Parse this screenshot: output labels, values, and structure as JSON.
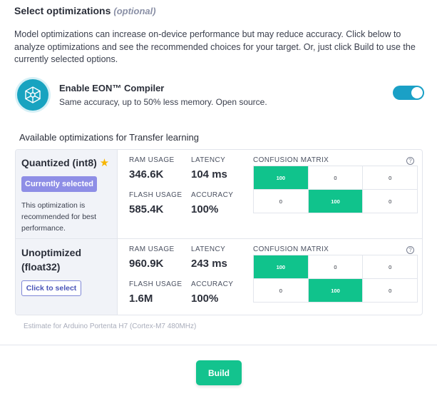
{
  "section": {
    "title": "Select optimizations",
    "optional_label": "(optional)"
  },
  "intro": "Model optimizations can increase on-device performance but may reduce accuracy. Click below to analyze optimizations and see the recommended choices for your target. Or, just click Build to use the currently selected options.",
  "eon": {
    "icon": "eon-compiler-icon",
    "title": "Enable EON™ Compiler",
    "subtitle": "Same accuracy, up to 50% less memory. Open source.",
    "enabled": true
  },
  "available_title": "Available optimizations for Transfer learning",
  "labels": {
    "ram": "RAM USAGE",
    "latency": "LATENCY",
    "flash": "FLASH USAGE",
    "accuracy": "ACCURACY",
    "confusion": "CONFUSION MATRIX",
    "help": "?"
  },
  "options": [
    {
      "name": "Quantized (int8)",
      "starred": true,
      "badge": "Currently selected",
      "note": "This optimization is recommended for best performance.",
      "ram": "346.6K",
      "latency": "104 ms",
      "flash": "585.4K",
      "accuracy": "100%",
      "matrix": [
        [
          "100",
          "0",
          "0"
        ],
        [
          "0",
          "100",
          "0"
        ]
      ]
    },
    {
      "name_line1": "Unoptimized",
      "name_line2": "(float32)",
      "button": "Click to select",
      "ram": "960.9K",
      "latency": "243 ms",
      "flash": "1.6M",
      "accuracy": "100%",
      "matrix": [
        [
          "100",
          "0",
          "0"
        ],
        [
          "0",
          "100",
          "0"
        ]
      ]
    }
  ],
  "estimate": "Estimate for Arduino Portenta H7 (Cortex-M7 480MHz)",
  "build_label": "Build",
  "colors": {
    "accent_green": "#13c38e",
    "toggle_blue": "#1aa0c6",
    "badge_purple": "#8e8ee6",
    "star": "#f7b500"
  }
}
